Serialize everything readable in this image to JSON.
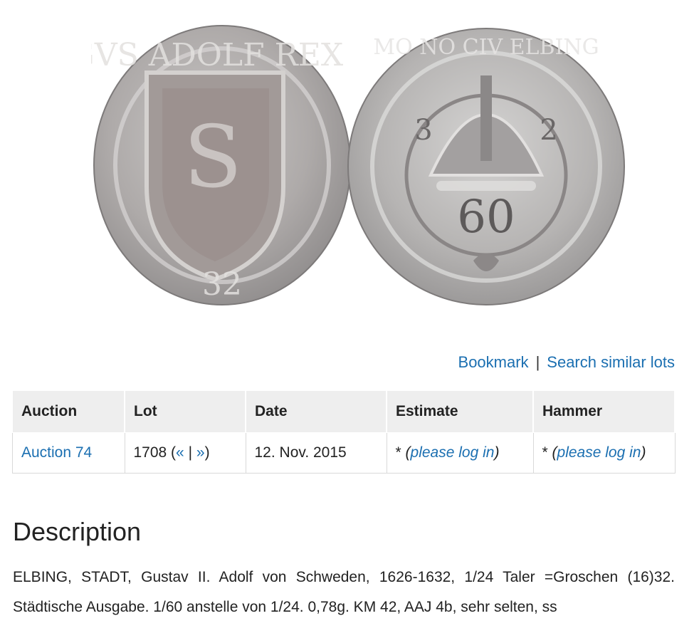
{
  "links": {
    "bookmark": "Bookmark",
    "separator": "|",
    "search_similar": "Search similar lots"
  },
  "table": {
    "headers": [
      "Auction",
      "Lot",
      "Date",
      "Estimate",
      "Hammer"
    ],
    "row": {
      "auction": "Auction 74",
      "lot_number": "1708",
      "lot_prev": "«",
      "lot_sep": "|",
      "lot_next": "»",
      "date": "12. Nov. 2015",
      "estimate_star": "*",
      "estimate_link": "please log in",
      "hammer_star": "*",
      "hammer_link": "please log in"
    }
  },
  "description": {
    "title": "Description",
    "text": "ELBING, STADT, Gustav II. Adolf von Schweden, 1626-1632, 1/24 Taler =Groschen (16)32. Städtische Ausgabe. 1/60 anstelle von 1/24. 0,78g. KM 42, AAJ 4b, sehr selten, ss"
  },
  "coin_images": {
    "obverse_legend": "GVS ADOLF REX S",
    "obverse_date": "32",
    "reverse_legend": "MO NO CIV ELBING",
    "reverse_value": "60",
    "reverse_side_marks": [
      "3",
      "2"
    ]
  },
  "colors": {
    "link": "#1b6fb1",
    "header_bg": "#eeeeee",
    "coin_silver": "#b9b9b9"
  }
}
